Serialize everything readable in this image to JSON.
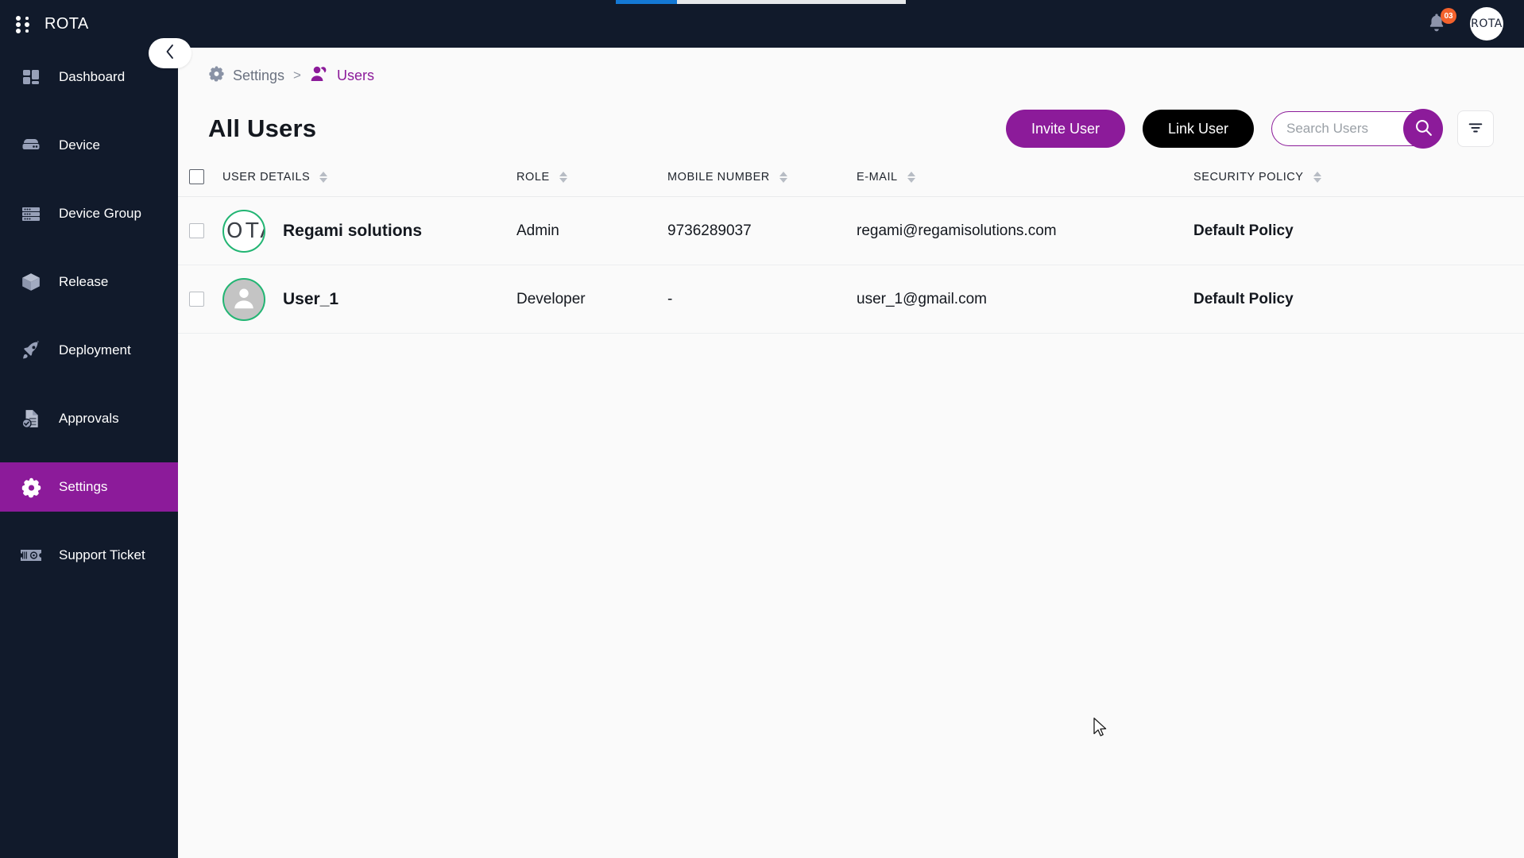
{
  "app": {
    "brand": "ROTA",
    "logo_icon": "dot-grid-icon",
    "user_avatar_initials": "ROTA",
    "notification_icon": "bell-icon",
    "notification_count": "03",
    "accent_purple": "#8c1b9a",
    "sidebar_bg": "#111a2b",
    "progress_blue": "#1478d4",
    "badge_orange": "#f4622c",
    "avatar_ring_green": "#22b573"
  },
  "progress": {
    "percent": 21
  },
  "sidebar": {
    "collapse_icon": "chevron-left-icon",
    "items": [
      {
        "label": "Dashboard",
        "icon": "dashboard-icon",
        "active": false
      },
      {
        "label": "Device",
        "icon": "device-icon",
        "active": false
      },
      {
        "label": "Device Group",
        "icon": "device-group-icon",
        "active": false
      },
      {
        "label": "Release",
        "icon": "release-box-icon",
        "active": false
      },
      {
        "label": "Deployment",
        "icon": "rocket-icon",
        "active": false
      },
      {
        "label": "Approvals",
        "icon": "approvals-doc-icon",
        "active": false
      },
      {
        "label": "Settings",
        "icon": "gear-icon",
        "active": true
      },
      {
        "label": "Support Ticket",
        "icon": "ticket-icon",
        "active": false
      }
    ]
  },
  "breadcrumb": {
    "items": [
      {
        "label": "Settings",
        "icon": "gear-icon",
        "current": false
      },
      {
        "label": "Users",
        "icon": "users-icon",
        "current": true
      }
    ],
    "separator": ">"
  },
  "page": {
    "title": "All Users"
  },
  "toolbar": {
    "invite_label": "Invite User",
    "link_label": "Link User",
    "search_placeholder": "Search Users",
    "search_value": "",
    "search_icon": "search-icon",
    "filter_icon": "filter-icon"
  },
  "table": {
    "columns": [
      {
        "label": "USER DETAILS",
        "sortable": true
      },
      {
        "label": "ROLE",
        "sortable": true
      },
      {
        "label": "MOBILE NUMBER",
        "sortable": true
      },
      {
        "label": "E-MAIL",
        "sortable": true
      },
      {
        "label": "SECURITY POLICY",
        "sortable": true
      }
    ],
    "rows": [
      {
        "selected": false,
        "avatar_type": "initials",
        "avatar_initials": "ROTA",
        "name": "Regami solutions",
        "role": "Admin",
        "mobile": "9736289037",
        "email": "regami@regamisolutions.com",
        "policy": "Default Policy"
      },
      {
        "selected": false,
        "avatar_type": "silhouette",
        "avatar_initials": "",
        "name": "User_1",
        "role": "Developer",
        "mobile": "-",
        "email": "user_1@gmail.com",
        "policy": "Default Policy"
      }
    ]
  }
}
